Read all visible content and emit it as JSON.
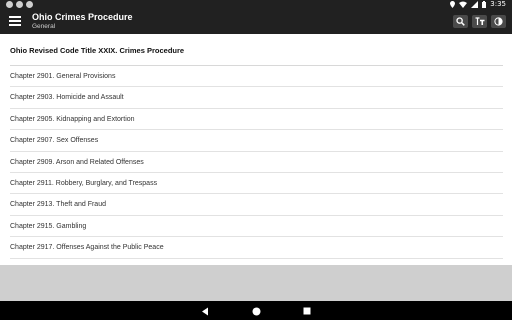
{
  "status_bar": {
    "time": "3:35",
    "notification_icons": [
      "notification-icon",
      "notification-icon",
      "notification-icon"
    ],
    "system_icons": [
      "location-icon",
      "wifi-icon",
      "signal-icon",
      "battery-icon"
    ]
  },
  "app_bar": {
    "title": "Ohio Crimes Procedure",
    "subtitle": "General",
    "menu_icon": "hamburger-menu-icon",
    "actions": [
      "search-icon",
      "text-size-icon",
      "contrast-icon"
    ]
  },
  "content": {
    "heading": "Ohio Revised Code Title XXIX. Crimes Procedure",
    "chapters": [
      "Chapter 2901. General Provisions",
      "Chapter 2903. Homicide and Assault",
      "Chapter 2905. Kidnapping and Extortion",
      "Chapter 2907. Sex Offenses",
      "Chapter 2909. Arson and Related Offenses",
      "Chapter 2911. Robbery, Burglary, and Trespass",
      "Chapter 2913. Theft and Fraud",
      "Chapter 2915. Gambling",
      "Chapter 2917. Offenses Against the Public Peace"
    ]
  },
  "navigation_bar": {
    "buttons": [
      "back-icon",
      "home-icon",
      "recents-icon"
    ]
  },
  "colors": {
    "app_bar": "#212121",
    "action_button": "#4a4a4a",
    "divider": "#e2e2e2",
    "bottom_area": "#cfcfcf"
  }
}
